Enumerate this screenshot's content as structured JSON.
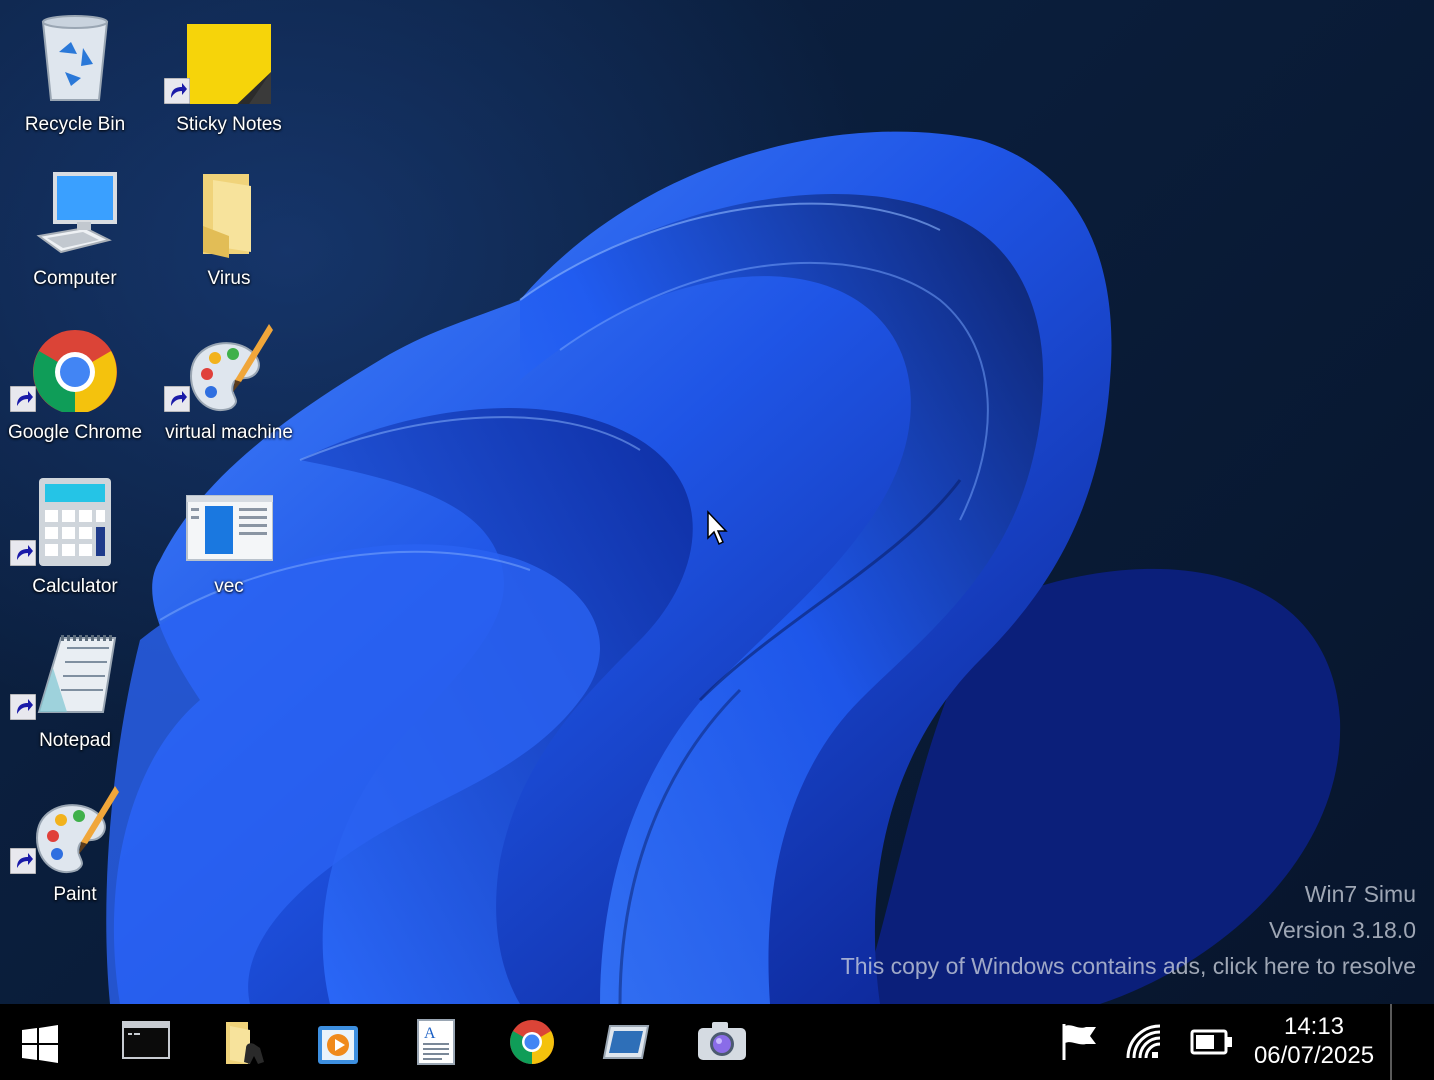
{
  "desktop": {
    "icons": [
      {
        "label": "Recycle Bin",
        "icon": "recycle-bin-icon",
        "shortcut": false
      },
      {
        "label": "Sticky Notes",
        "icon": "sticky-notes-icon",
        "shortcut": true
      },
      {
        "label": "Computer",
        "icon": "computer-icon",
        "shortcut": false
      },
      {
        "label": "Virus",
        "icon": "folder-icon",
        "shortcut": false
      },
      {
        "label": "Google Chrome",
        "icon": "chrome-icon",
        "shortcut": true
      },
      {
        "label": "virtual machine",
        "icon": "paint-palette-icon",
        "shortcut": true
      },
      {
        "label": "Calculator",
        "icon": "calculator-icon",
        "shortcut": true
      },
      {
        "label": "vec",
        "icon": "document-window-icon",
        "shortcut": false
      },
      {
        "label": "Notepad",
        "icon": "notepad-icon",
        "shortcut": true
      },
      {
        "label": "Paint",
        "icon": "paint-palette-icon",
        "shortcut": true
      }
    ],
    "watermark": {
      "line1": "Win7 Simu",
      "line2": "Version 3.18.0",
      "line3": "This copy of Windows contains ads, click here to resolve"
    }
  },
  "taskbar": {
    "pinned": [
      "start-windows-icon",
      "command-prompt-icon",
      "file-explorer-icon",
      "media-player-icon",
      "wordpad-icon",
      "chrome-icon",
      "remote-desktop-icon",
      "camera-icon"
    ],
    "tray": [
      "action-center-flag-icon",
      "wifi-icon",
      "battery-icon"
    ],
    "clock": {
      "time": "14:13",
      "date": "06/07/2025"
    }
  },
  "colors": {
    "background": "#0a1d3a",
    "wallpaper_blue": "#1e4fe0",
    "taskbar": "#000000",
    "watermark_text": "#c8ccd6"
  }
}
